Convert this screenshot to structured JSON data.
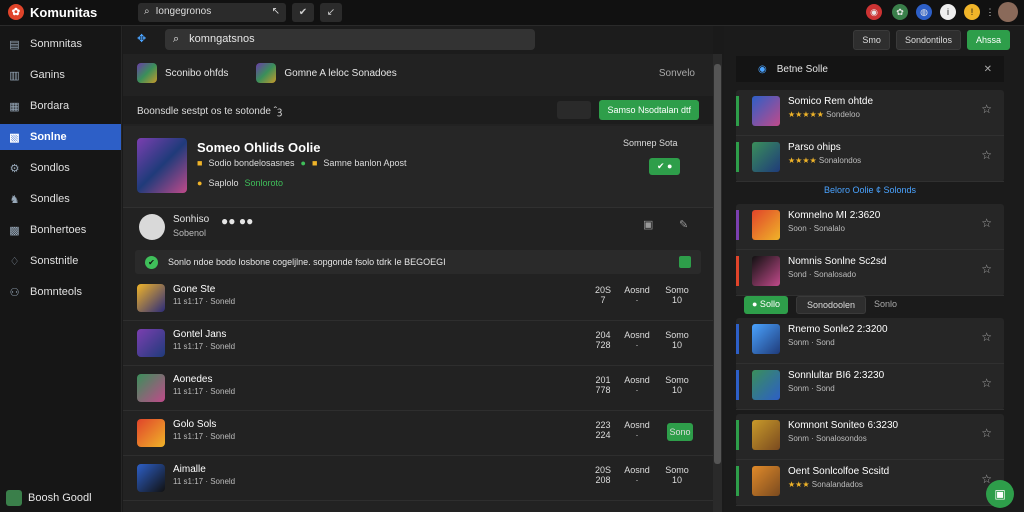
{
  "app": {
    "title": "Komunitas",
    "badge": "✿"
  },
  "top": {
    "search": "Iongegronos",
    "btn1": "↖",
    "btn2": "✔",
    "btn3": "↙"
  },
  "sidebar": {
    "items": [
      {
        "label": "Sonmnitas",
        "icon": "▤"
      },
      {
        "label": "Ganins",
        "icon": "▥"
      },
      {
        "label": "Bordara",
        "icon": "▦"
      },
      {
        "label": "Sonlne",
        "icon": "▧",
        "active": true
      },
      {
        "label": "Sondlos",
        "icon": "⚙"
      },
      {
        "label": "Sondles",
        "icon": "♞"
      },
      {
        "label": "Bonhertoes",
        "icon": "▩"
      },
      {
        "label": "Sonstnitle",
        "icon": "♢"
      },
      {
        "label": "Bomnteols",
        "icon": "⚇"
      }
    ],
    "footer": "Boosh Goodl"
  },
  "main": {
    "search": "komngatsnos",
    "friends": {
      "a": "Sconibo ohfds",
      "b": "Gomne A leloc Sonadoes",
      "right": "Sonvelo"
    },
    "banner": {
      "text": "Boonsdle sestpt os te sotonde ˆꝫ",
      "btn": "Samso Nsodtalan dtf"
    },
    "game": {
      "title": "Someo Ohlids Oolie",
      "l1": "Sodio bondelosasnes",
      "l2": "Samne banlon Apost",
      "l3a": "Saplolo",
      "l3b": "Sonloroto",
      "tag": "Somnep Sota",
      "tagbtn": "✔ ●"
    },
    "profile": {
      "name": "Sonhiso",
      "sub": "Sobenol",
      "dots": "●● ●●"
    },
    "note": "Sonlo ndoe bodo losbone cogeljlne. sopgonde fsolo tdrk Ie BEGOEGI",
    "rows": [
      {
        "name": "Gone Ste",
        "sub": "11 s1:17 · Soneld",
        "c1": "20S\n7",
        "c2": "Aosnd\n·",
        "c3": "Somo\n10"
      },
      {
        "name": "Gontel Jans",
        "sub": "11 s1:17 · Soneld",
        "c1": "204\n728",
        "c2": "Aosnd\n·",
        "c3": "Somo\n10"
      },
      {
        "name": "Aonedes",
        "sub": "11 s1:17 · Soneld",
        "c1": "201\n778",
        "c2": "Aosnd\n·",
        "c3": "Somo\n10"
      },
      {
        "name": "Golo Sols",
        "sub": "11 s1:17 · Soneld",
        "c1": "223\n224",
        "c2": "Aosnd\n·",
        "c3": "Sono"
      },
      {
        "name": "Aimalle",
        "sub": "11 s1:17 · Soneld",
        "c1": "20S\n208",
        "c2": "Aosnd\n·",
        "c3": "Somo\n10"
      }
    ]
  },
  "right": {
    "top": {
      "a": "Smo",
      "b": "Sondontilos",
      "c": "Ahssa"
    },
    "head": "Betne Solle",
    "p1": [
      {
        "name": "Somico Rem ohtde",
        "stars": "★★★★★",
        "sub": "Sondeloo"
      },
      {
        "name": "Parso ohips",
        "stars": "★★★★",
        "sub": "Sonalondos"
      }
    ],
    "sep1": "Beloro Oolie ¢ Solonds",
    "p2": [
      {
        "name": "Komnelno MI 2:3620",
        "sub": "Soon · Sonalalo"
      },
      {
        "name": "Nomnis Sonlne Sc2sd",
        "sub": "Sond · Sonalosado"
      }
    ],
    "mid": {
      "a": "● Sollo",
      "b": "Sonodoolen",
      "c": "Sonlo"
    },
    "p3": [
      {
        "name": "Rnemo Sonle2 2:3200",
        "sub": "Sonm · Sond"
      },
      {
        "name": "Sonnlultar BI6 2:3230",
        "sub": "Sonm · Sond"
      }
    ],
    "p4": [
      {
        "name": "Komnont Soniteo 6:3230",
        "sub": "Sonm · Sonalosondos"
      },
      {
        "name": "Oent Sonlcolfoe Scsitd",
        "stars": "★★★",
        "sub": "Sonalandados"
      }
    ]
  },
  "colors": {
    "accent": "#2e9e4a",
    "active": "#2d5fc7"
  }
}
